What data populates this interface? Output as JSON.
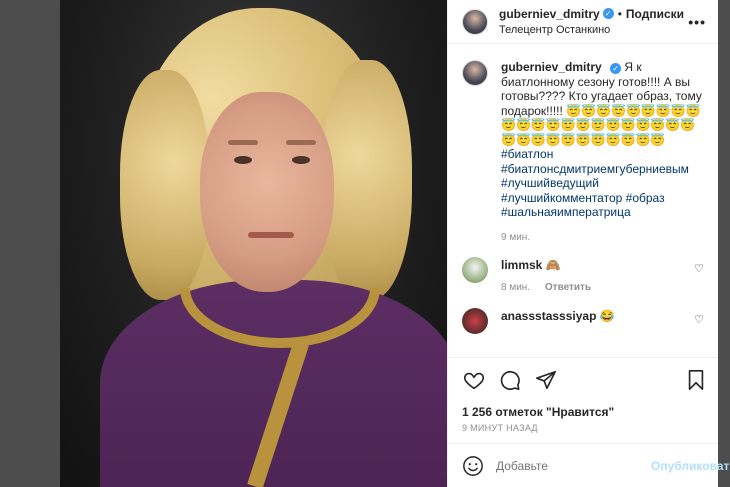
{
  "header": {
    "username": "guberniev_dmitry",
    "dot": "•",
    "follow": "Подписки",
    "location": "Телецентр Останкино",
    "more_glyph": "•••"
  },
  "caption": {
    "username": "guberniev_dmitry",
    "text": "Я к биатлонному сезону готов!!!! А вы готовы???? Кто угадает образ, тому подарок!!!!!",
    "emojis": "😇😇😇😇😇😇😇😇😇😇😇😇😇😇😇😇😇😇😇😇😇😇😇😇😇😇😇😇😇😇😇😇😇",
    "hashtags": [
      "#биатлон",
      "#биатлонсдмитриемгуберниевым",
      "#лучшийведущий",
      "#лучшийкомментатор",
      "#образ",
      "#шальнаяимператрица"
    ],
    "time": "9 мин."
  },
  "comments": [
    {
      "username": "limmsk",
      "emoji": "🙈",
      "time": "8 мин.",
      "reply": "Ответить"
    },
    {
      "username": "anassstasssiyap",
      "emoji": "😂"
    }
  ],
  "likes": "1 256 отметок \"Нравится\"",
  "posted_ago": "9 минут назад",
  "add_comment": {
    "placeholder": "Добавьте",
    "publish": "Опубликовать"
  },
  "colors": {
    "verified": "#3897f0",
    "link": "#00376b",
    "publish": "#b2dffc"
  },
  "icons": [
    "heart-icon",
    "comment-icon",
    "share-icon",
    "bookmark-icon",
    "emoji-icon"
  ]
}
